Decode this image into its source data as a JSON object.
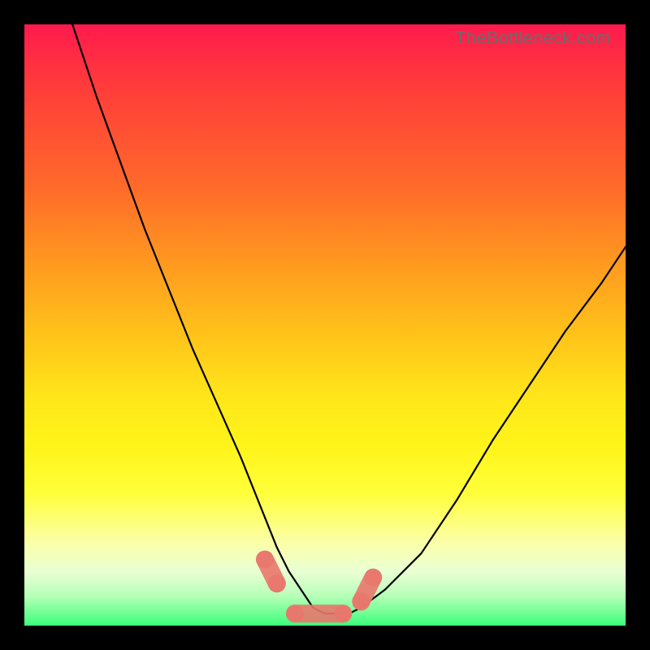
{
  "watermark": "TheBottleneck.com",
  "colors": {
    "frame_bg": "#000000",
    "gradient_top": "#ff1a4d",
    "gradient_bottom": "#3bff7a",
    "curve": "#000000",
    "scatter": "#e9776e",
    "watermark": "#6b6b6b"
  },
  "chart_data": {
    "type": "line",
    "title": "",
    "xlabel": "",
    "ylabel": "",
    "xlim": [
      0,
      100
    ],
    "ylim": [
      0,
      100
    ],
    "grid": false,
    "legend": false,
    "series": [
      {
        "name": "bottleneck-curve",
        "x": [
          8,
          12,
          16,
          20,
          24,
          28,
          32,
          36,
          40,
          42,
          44,
          46,
          48,
          50,
          52,
          54,
          56,
          60,
          66,
          72,
          78,
          84,
          90,
          96,
          100
        ],
        "values": [
          100,
          88,
          77,
          66,
          56,
          46,
          37,
          28,
          18,
          13,
          9,
          6,
          3,
          2,
          2,
          2,
          3,
          6,
          12,
          21,
          31,
          40,
          49,
          57,
          63
        ]
      }
    ],
    "scatter": [
      {
        "name": "marker-left-upper",
        "x": 40,
        "y": 11
      },
      {
        "name": "marker-left-lower",
        "x": 42,
        "y": 7
      },
      {
        "name": "flat-segment-start",
        "x": 45,
        "y": 2
      },
      {
        "name": "flat-segment-end",
        "x": 53,
        "y": 2
      },
      {
        "name": "marker-right-elbow",
        "x": 56,
        "y": 4
      },
      {
        "name": "marker-right-upper",
        "x": 58,
        "y": 8
      }
    ],
    "annotations": [
      {
        "name": "watermark",
        "text": "TheBottleneck.com",
        "pos": "top-right"
      }
    ]
  }
}
